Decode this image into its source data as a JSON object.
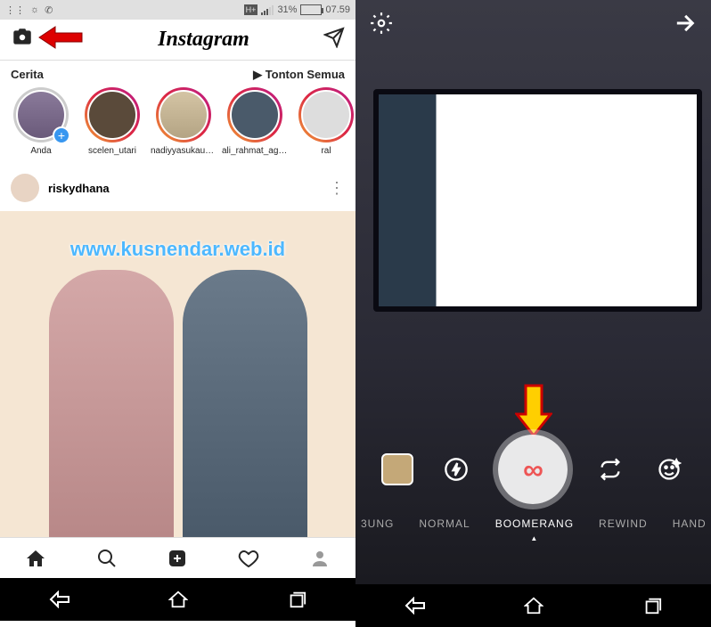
{
  "status": {
    "network_indicator": "H+",
    "battery_pct": "31%",
    "time": "07.59"
  },
  "ig": {
    "logo": "Instagram",
    "stories_label": "Cerita",
    "watch_all": "Tonton Semua",
    "stories": [
      {
        "name": "Anda",
        "own": true
      },
      {
        "name": "scelen_utari"
      },
      {
        "name": "nadiyyasukaungu"
      },
      {
        "name": "ali_rahmat_agr..."
      },
      {
        "name": "ral"
      }
    ],
    "post_user": "riskydhana"
  },
  "watermark": "www.kusnendar.web.id",
  "camera": {
    "modes": [
      "3UNG",
      "NORMAL",
      "BOOMERANG",
      "REWIND",
      "HAND"
    ],
    "active_mode": "BOOMERANG"
  }
}
